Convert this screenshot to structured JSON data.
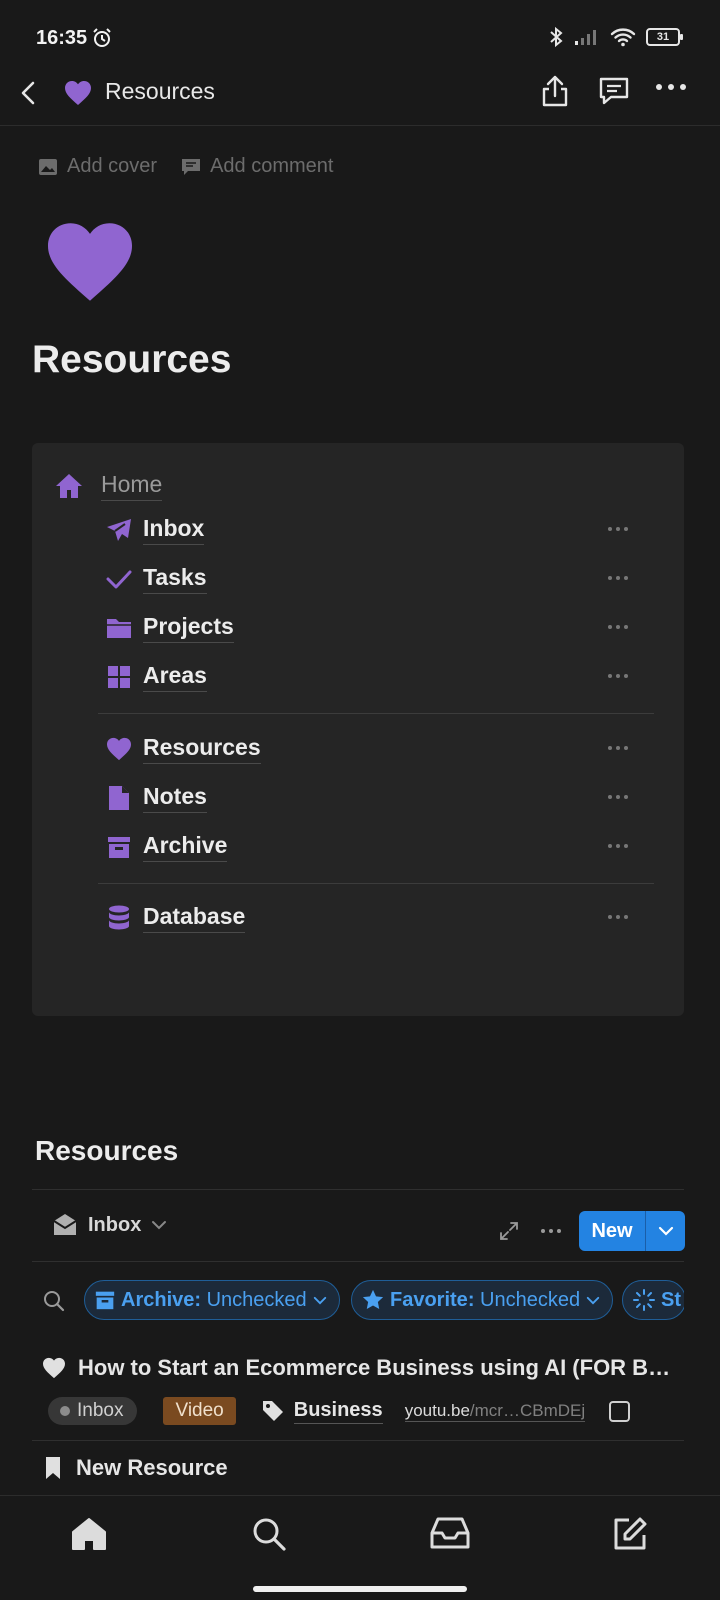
{
  "status_bar": {
    "time": "16:35",
    "battery": "31"
  },
  "header": {
    "title": "Resources"
  },
  "meta": {
    "add_cover": "Add cover",
    "add_comment": "Add comment"
  },
  "page": {
    "title": "Resources",
    "icon": "purple-heart"
  },
  "nav": {
    "home_label": "Home",
    "items": [
      {
        "label": "Inbox",
        "icon": "paper-plane-icon"
      },
      {
        "label": "Tasks",
        "icon": "check-icon"
      },
      {
        "label": "Projects",
        "icon": "folder-icon"
      },
      {
        "label": "Areas",
        "icon": "grid-icon"
      },
      {
        "label": "Resources",
        "icon": "heart-icon"
      },
      {
        "label": "Notes",
        "icon": "file-icon"
      },
      {
        "label": "Archive",
        "icon": "archive-box-icon"
      },
      {
        "label": "Database",
        "icon": "database-icon"
      }
    ]
  },
  "database": {
    "title": "Resources",
    "view_label": "Inbox",
    "new_label": "New",
    "filters": [
      {
        "key": "Archive",
        "value": "Unchecked"
      },
      {
        "key": "Favorite",
        "value": "Unchecked"
      },
      {
        "key": "St",
        "value": ""
      }
    ],
    "rows": [
      {
        "title": "How to Start an Ecommerce Business using AI (FOR B…",
        "status": "Inbox",
        "type": "Video",
        "tag": "Business",
        "url_host": "youtu.be",
        "url_path": "/mcr…CBmDEj"
      }
    ],
    "new_row_label": "New Resource"
  },
  "colors": {
    "accent_purple": "#9065d0",
    "button_blue": "#2383e2",
    "chip_blue": "#4aa0f0"
  }
}
